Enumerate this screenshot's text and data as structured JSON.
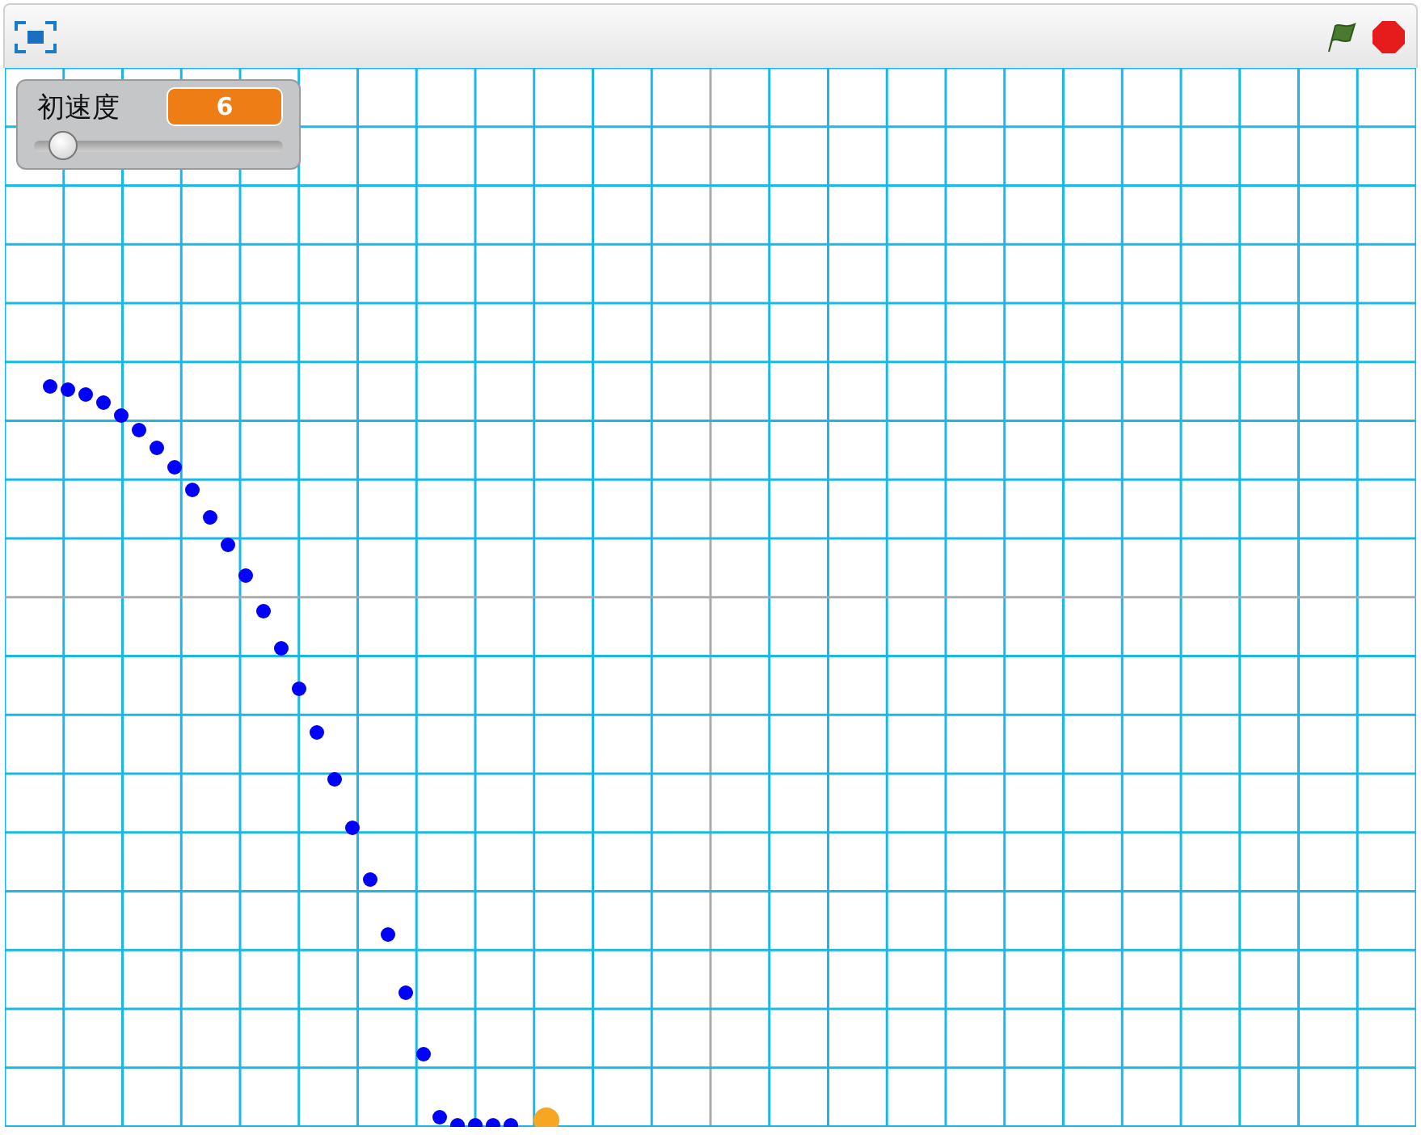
{
  "monitor": {
    "label": "初速度",
    "value": "6",
    "slider": {
      "level": 0.12
    }
  }
}
